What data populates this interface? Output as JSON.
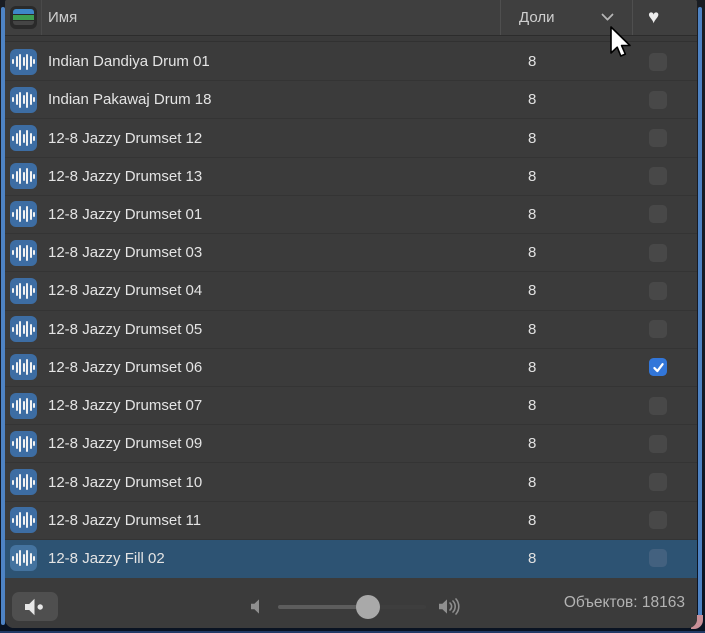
{
  "header": {
    "name_label": "Имя",
    "beats_label": "Доли",
    "favorites_glyph": "♥"
  },
  "rows": [
    {
      "name": "Indian Dandiya Drum 01",
      "beats": "8",
      "favorite": false,
      "selected": false
    },
    {
      "name": "Indian Pakawaj Drum 18",
      "beats": "8",
      "favorite": false,
      "selected": false
    },
    {
      "name": "12-8 Jazzy Drumset 12",
      "beats": "8",
      "favorite": false,
      "selected": false
    },
    {
      "name": "12-8 Jazzy Drumset 13",
      "beats": "8",
      "favorite": false,
      "selected": false
    },
    {
      "name": "12-8 Jazzy Drumset 01",
      "beats": "8",
      "favorite": false,
      "selected": false
    },
    {
      "name": "12-8 Jazzy Drumset 03",
      "beats": "8",
      "favorite": false,
      "selected": false
    },
    {
      "name": "12-8 Jazzy Drumset 04",
      "beats": "8",
      "favorite": false,
      "selected": false
    },
    {
      "name": "12-8 Jazzy Drumset 05",
      "beats": "8",
      "favorite": false,
      "selected": false
    },
    {
      "name": "12-8 Jazzy Drumset 06",
      "beats": "8",
      "favorite": true,
      "selected": false
    },
    {
      "name": "12-8 Jazzy Drumset 07",
      "beats": "8",
      "favorite": false,
      "selected": false
    },
    {
      "name": "12-8 Jazzy Drumset 09",
      "beats": "8",
      "favorite": false,
      "selected": false
    },
    {
      "name": "12-8 Jazzy Drumset 10",
      "beats": "8",
      "favorite": false,
      "selected": false
    },
    {
      "name": "12-8 Jazzy Drumset 11",
      "beats": "8",
      "favorite": false,
      "selected": false
    },
    {
      "name": "12-8 Jazzy Fill 02",
      "beats": "8",
      "favorite": false,
      "selected": true
    }
  ],
  "footer": {
    "count_label": "Объектов: 18163",
    "volume_percent": 61
  },
  "icons": {
    "view_toggle": "loop-pack-stripes-icon",
    "sort": "chevron-down-icon",
    "favorites": "heart-icon",
    "row": "audio-waveform-icon",
    "audition": "speaker-dot-icon",
    "volume_min": "speaker-icon",
    "volume_max": "speaker-waves-icon",
    "cursor": "arrow-cursor"
  },
  "colors": {
    "panel": "#3b3b3b",
    "header": "#3f3f3f",
    "selected_row": "#2d5373",
    "checkbox_checked": "#3276d9",
    "loop_icon": "#3d6da3",
    "accent_edge": "#4e83c4"
  }
}
